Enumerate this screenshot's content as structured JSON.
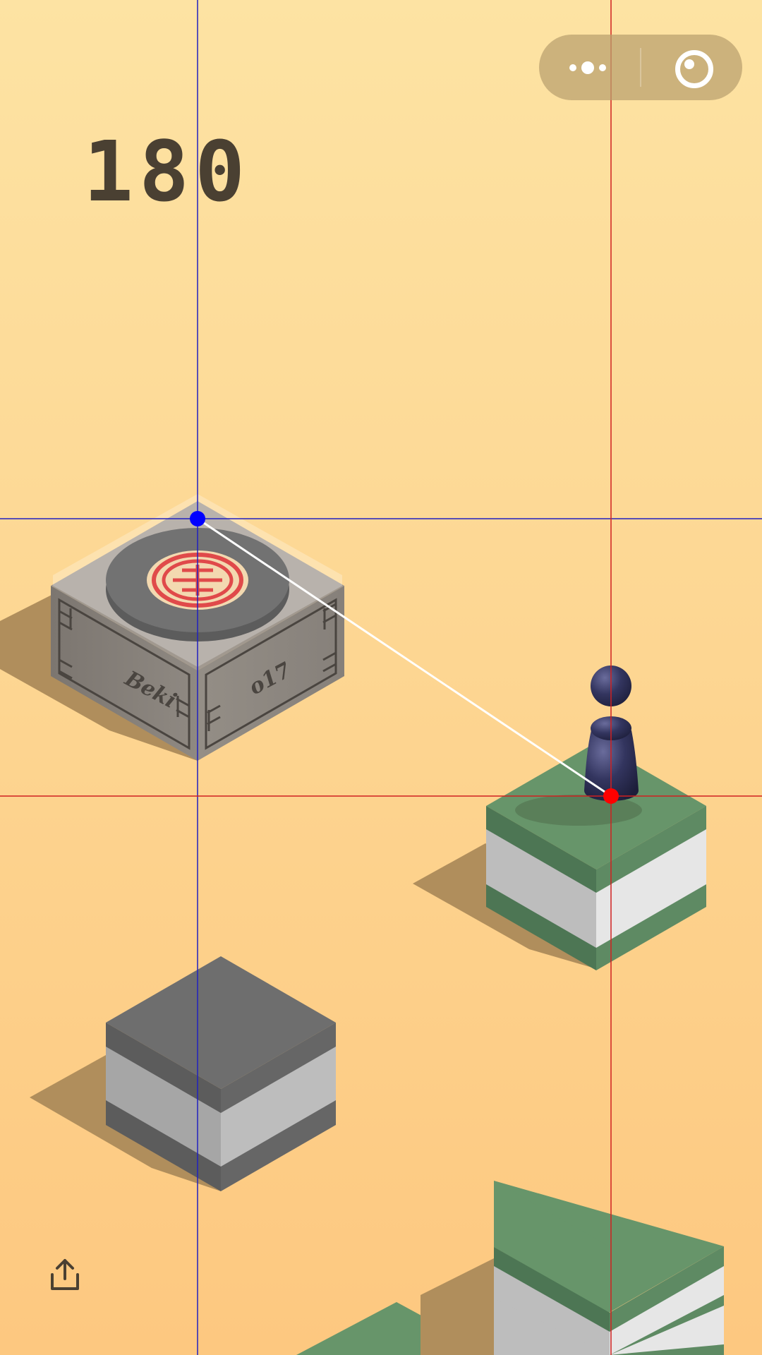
{
  "score": "180",
  "capsule": {
    "more_icon": "more-dots-icon",
    "close_icon": "target-close-icon"
  },
  "share_icon": "share-upload-icon",
  "box_text": {
    "left_face": "Beki",
    "right_face": "o17"
  },
  "colors": {
    "sky_top": "#fde3a3",
    "sky_bottom": "#fdc880",
    "score": "#4a4032",
    "green_top": "#67956a",
    "green_side_dark": "#4d7654",
    "stripe_light": "#e6e6e6",
    "stripe_mid": "#bdbdbd",
    "gray_top": "#6e6e6e",
    "player": "#2c2d58",
    "target_point": "#0000ff",
    "player_point": "#ff0000"
  }
}
